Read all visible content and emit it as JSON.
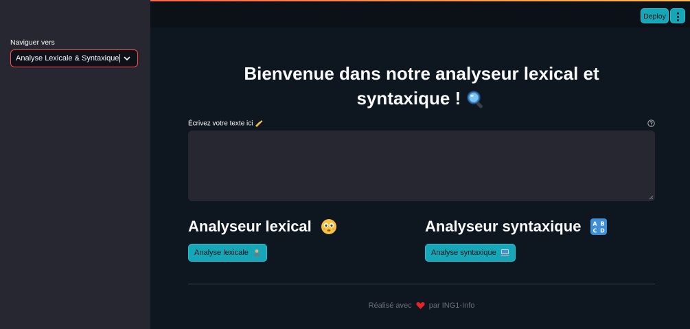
{
  "header": {
    "deploy_label": "Deploy",
    "menu_icon": "vertical-dots-icon"
  },
  "sidebar": {
    "nav_label": "Naviguer vers",
    "select": {
      "value": "Analyse Lexicale & Syntaxique",
      "icon": "chevron-down-icon"
    }
  },
  "main": {
    "title_line1": "Bienvenue dans notre analyseur lexical et",
    "title_line2": "syntaxique !",
    "title_emoji": "magnifier-icon",
    "input": {
      "label": "Écrivez votre texte ici",
      "label_emoji": "writing-hand-icon",
      "value": "",
      "help_icon": "question-circle-icon"
    },
    "lexical": {
      "heading": "Analyseur lexical",
      "heading_emoji": "flushed-face-icon",
      "button_label": "Analyse lexicale",
      "button_emoji": "person-icon"
    },
    "syntactic": {
      "heading": "Analyseur syntaxique",
      "heading_emoji": "abcd-icon",
      "button_label": "Analyse syntaxique",
      "button_emoji": "computer-icon"
    },
    "footer": {
      "prefix": "Réalisé avec",
      "heart_icon": "heart-icon",
      "suffix": "par ING1-Info"
    }
  },
  "colors": {
    "accent": "#15a6b8",
    "sidebar_bg": "#262730",
    "main_bg": "#0e1720",
    "select_border": "#ff4b4b"
  }
}
